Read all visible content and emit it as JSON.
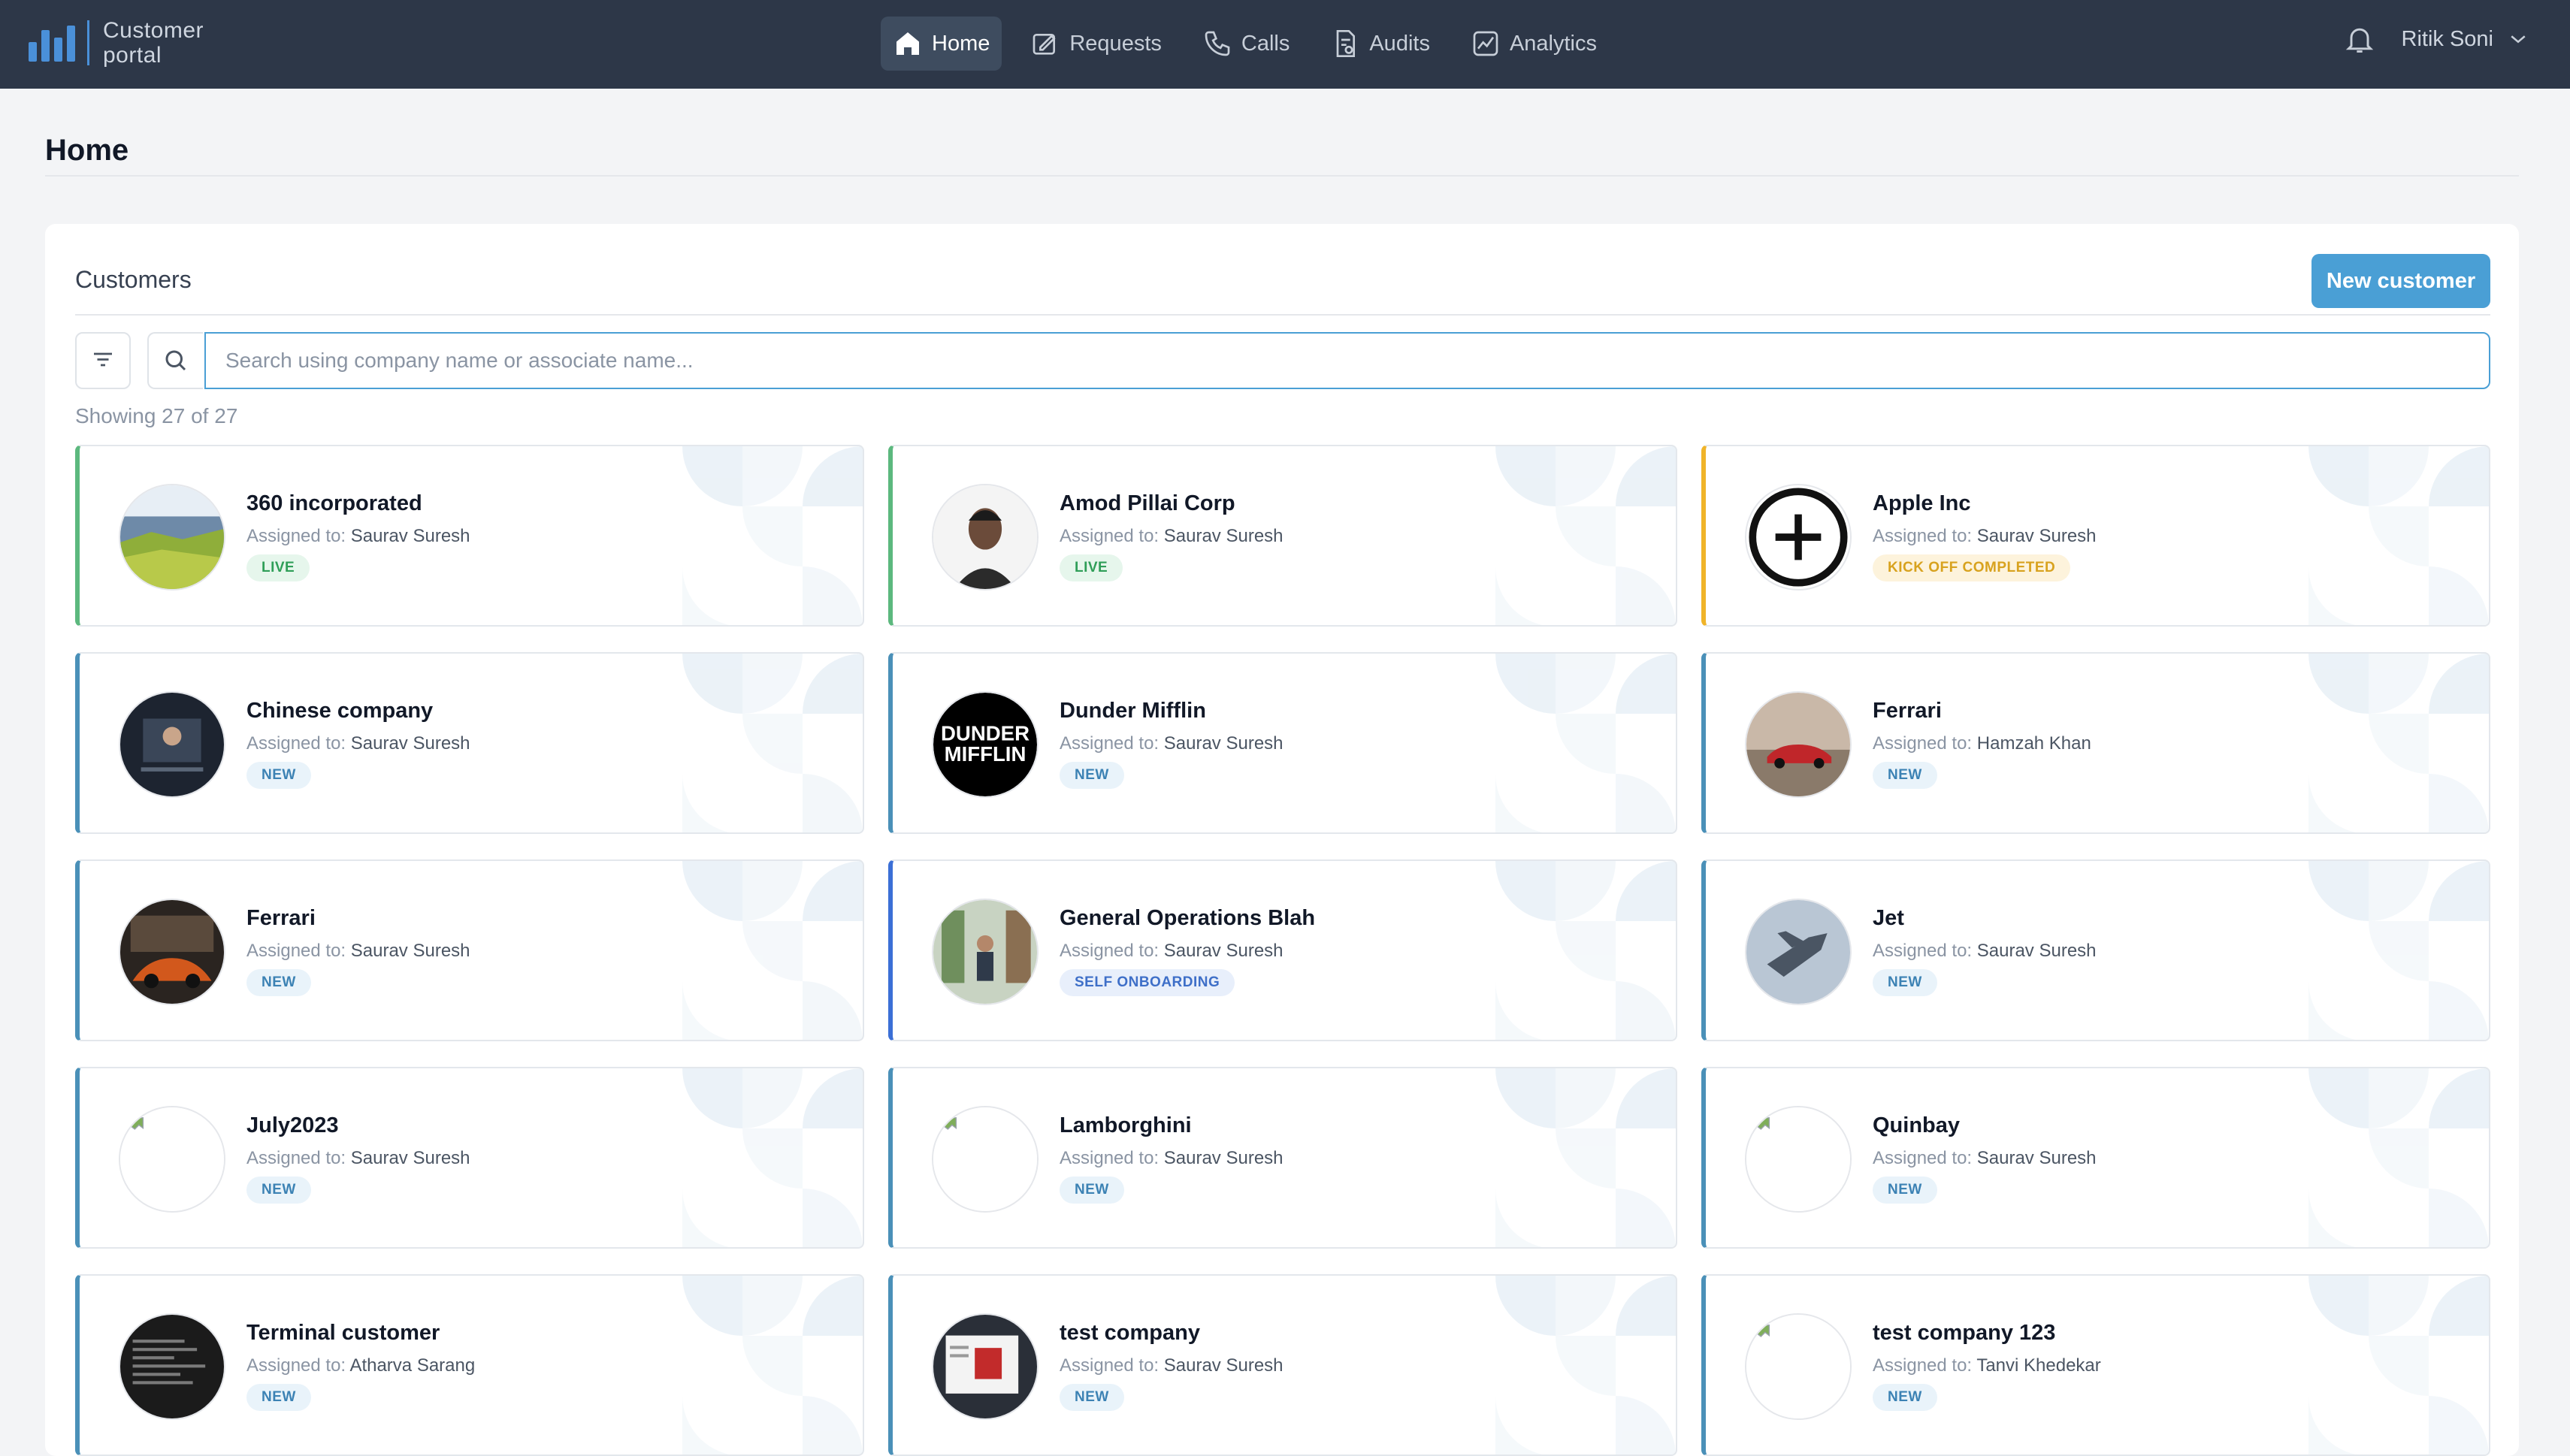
{
  "app": {
    "logo_line1": "Customer",
    "logo_line2": "portal",
    "accent": "#4a9fd5"
  },
  "nav": {
    "home": "Home",
    "requests": "Requests",
    "calls": "Calls",
    "audits": "Audits",
    "analytics": "Analytics"
  },
  "user": {
    "name": "Ritik Soni"
  },
  "page": {
    "title": "Home"
  },
  "customers": {
    "title": "Customers",
    "new_button": "New customer",
    "search_placeholder": "Search using company name or associate name...",
    "showing": "Showing 27 of 27",
    "assigned_prefix": "Assigned to:",
    "cards": [
      {
        "name": "360 incorporated",
        "assignee": "Saurav Suresh",
        "status": "LIVE",
        "avatar": "landscape-photo"
      },
      {
        "name": "Amod Pillai Corp",
        "assignee": "Saurav Suresh",
        "status": "LIVE",
        "avatar": "person-photo"
      },
      {
        "name": "Apple Inc",
        "assignee": "Saurav Suresh",
        "status": "KICK OFF COMPLETED",
        "avatar": "plus-circle-icon"
      },
      {
        "name": "Chinese company",
        "assignee": "Saurav Suresh",
        "status": "NEW",
        "avatar": "screen-photo"
      },
      {
        "name": "Dunder Mifflin",
        "assignee": "Saurav Suresh",
        "status": "NEW",
        "avatar": "dunder-mifflin-logo"
      },
      {
        "name": "Ferrari",
        "assignee": "Hamzah Khan",
        "status": "NEW",
        "avatar": "red-car-photo"
      },
      {
        "name": "Ferrari",
        "assignee": "Saurav Suresh",
        "status": "NEW",
        "avatar": "orange-car-photo"
      },
      {
        "name": "General Operations Blah",
        "assignee": "Saurav Suresh",
        "status": "SELF ONBOARDING",
        "avatar": "office-photo"
      },
      {
        "name": "Jet",
        "assignee": "Saurav Suresh",
        "status": "NEW",
        "avatar": "jet-photo"
      },
      {
        "name": "July2023",
        "assignee": "Saurav Suresh",
        "status": "NEW",
        "avatar": "broken-image-icon"
      },
      {
        "name": "Lamborghini",
        "assignee": "Saurav Suresh",
        "status": "NEW",
        "avatar": "broken-image-icon"
      },
      {
        "name": "Quinbay",
        "assignee": "Saurav Suresh",
        "status": "NEW",
        "avatar": "broken-image-icon"
      },
      {
        "name": "Terminal customer",
        "assignee": "Atharva Sarang",
        "status": "NEW",
        "avatar": "terminal-photo"
      },
      {
        "name": "test company",
        "assignee": "Saurav Suresh",
        "status": "NEW",
        "avatar": "dashboard-photo"
      },
      {
        "name": "test company 123",
        "assignee": "Tanvi Khedekar",
        "status": "NEW",
        "avatar": "broken-image-icon"
      }
    ]
  }
}
